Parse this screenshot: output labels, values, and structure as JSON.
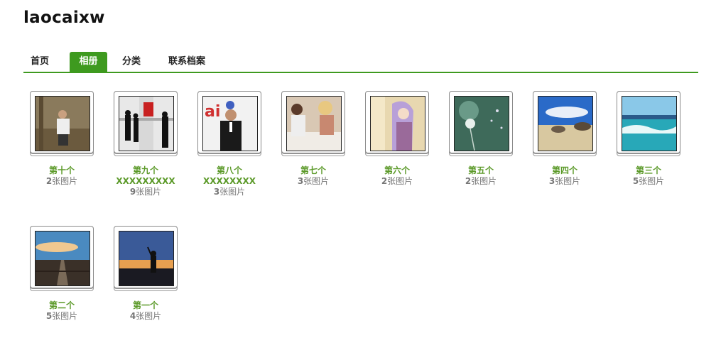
{
  "site": {
    "title": "laocaixw"
  },
  "nav": {
    "items": [
      {
        "label": "首页"
      },
      {
        "label": "相册"
      },
      {
        "label": "分类"
      },
      {
        "label": "联系档案"
      }
    ]
  },
  "albums": [
    {
      "name": "第十个",
      "count": "2",
      "count_suffix": "张图片"
    },
    {
      "name": "第九个 XXXXXXXXX",
      "count": "9",
      "count_suffix": "张图片"
    },
    {
      "name": "第八个 XXXXXXXX",
      "count": "3",
      "count_suffix": "张图片"
    },
    {
      "name": "第七个",
      "count": "3",
      "count_suffix": "张图片"
    },
    {
      "name": "第六个",
      "count": "2",
      "count_suffix": "张图片"
    },
    {
      "name": "第五个",
      "count": "2",
      "count_suffix": "张图片"
    },
    {
      "name": "第四个",
      "count": "3",
      "count_suffix": "张图片"
    },
    {
      "name": "第三个",
      "count": "5",
      "count_suffix": "张图片"
    },
    {
      "name": "第二个",
      "count": "5",
      "count_suffix": "张图片"
    },
    {
      "name": "第一个",
      "count": "4",
      "count_suffix": "张图片"
    }
  ],
  "colors": {
    "accent": "#3e9a1f",
    "album_name": "#5c9a2a"
  }
}
